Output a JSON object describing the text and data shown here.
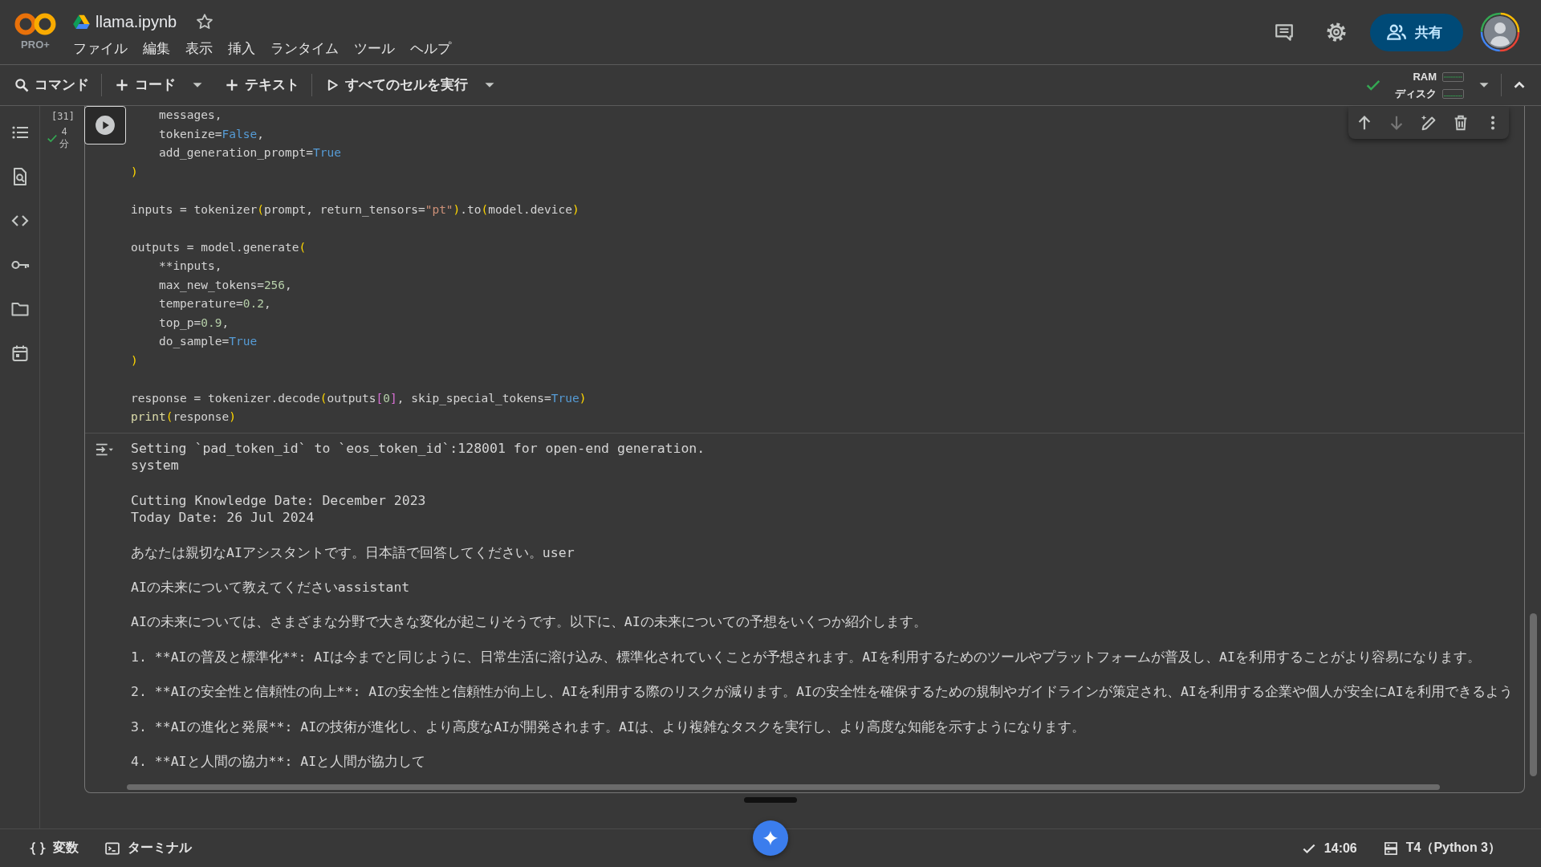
{
  "header": {
    "plan_badge": "PRO+",
    "title": "llama.ipynb",
    "starred": false,
    "menu": [
      "ファイル",
      "編集",
      "表示",
      "挿入",
      "ランタイム",
      "ツール",
      "ヘルプ"
    ],
    "share_button": "共有"
  },
  "toolbar": {
    "command": "コマンド",
    "add_code": "コード",
    "add_text": "テキスト",
    "run_all": "すべてのセルを実行",
    "connected": true,
    "resources": [
      {
        "label": "RAM"
      },
      {
        "label": "ディスク"
      }
    ]
  },
  "cell": {
    "execution_count": "[31]",
    "succeeded": true,
    "elapsed_value": "4",
    "elapsed_unit": "分",
    "toolbar": [
      {
        "disabled": false
      },
      {
        "disabled": true
      },
      {
        "disabled": false
      },
      {
        "disabled": false
      },
      {
        "disabled": false
      }
    ],
    "code_blocks": [
      [
        [
          {
            "text": "    messages,",
            "kind": "plain"
          }
        ],
        [
          {
            "text": "    tokenize=",
            "kind": "plain"
          },
          {
            "text": "False",
            "kind": "const"
          },
          {
            "text": ",",
            "kind": "plain"
          }
        ],
        [
          {
            "text": "    add_generation_prompt=",
            "kind": "plain"
          },
          {
            "text": "True",
            "kind": "const"
          }
        ],
        [
          {
            "text": ")",
            "kind": "paren"
          }
        ]
      ],
      [
        [
          {
            "text": "inputs = tokenizer",
            "kind": "plain"
          },
          {
            "text": "(",
            "kind": "paren"
          },
          {
            "text": "prompt, return_tensors=",
            "kind": "plain"
          },
          {
            "text": "\"pt\"",
            "kind": "str"
          },
          {
            "text": ")",
            "kind": "paren"
          },
          {
            "text": ".to",
            "kind": "plain"
          },
          {
            "text": "(",
            "kind": "paren"
          },
          {
            "text": "model.device",
            "kind": "plain"
          },
          {
            "text": ")",
            "kind": "paren"
          }
        ]
      ],
      [
        [
          {
            "text": "outputs = model.generate",
            "kind": "plain"
          },
          {
            "text": "(",
            "kind": "paren"
          }
        ],
        [
          {
            "text": "    **inputs,",
            "kind": "plain"
          }
        ],
        [
          {
            "text": "    max_new_tokens=",
            "kind": "plain"
          },
          {
            "text": "256",
            "kind": "num"
          },
          {
            "text": ",",
            "kind": "plain"
          }
        ],
        [
          {
            "text": "    temperature=",
            "kind": "plain"
          },
          {
            "text": "0.2",
            "kind": "num"
          },
          {
            "text": ",",
            "kind": "plain"
          }
        ],
        [
          {
            "text": "    top_p=",
            "kind": "plain"
          },
          {
            "text": "0.9",
            "kind": "num"
          },
          {
            "text": ",",
            "kind": "plain"
          }
        ],
        [
          {
            "text": "    do_sample=",
            "kind": "plain"
          },
          {
            "text": "True",
            "kind": "const"
          }
        ],
        [
          {
            "text": ")",
            "kind": "paren"
          }
        ]
      ],
      [
        [
          {
            "text": "response = tokenizer.decode",
            "kind": "plain"
          },
          {
            "text": "(",
            "kind": "paren"
          },
          {
            "text": "outputs",
            "kind": "plain"
          },
          {
            "text": "[",
            "kind": "bracket"
          },
          {
            "text": "0",
            "kind": "num"
          },
          {
            "text": "]",
            "kind": "bracket"
          },
          {
            "text": ", skip_special_tokens=",
            "kind": "plain"
          },
          {
            "text": "True",
            "kind": "const"
          },
          {
            "text": ")",
            "kind": "paren"
          }
        ],
        [
          {
            "text": "print",
            "kind": "fn"
          },
          {
            "text": "(",
            "kind": "paren"
          },
          {
            "text": "response",
            "kind": "plain"
          },
          {
            "text": ")",
            "kind": "paren"
          }
        ]
      ]
    ],
    "output_blocks": [
      [
        "Setting `pad_token_id` to `eos_token_id`:128001 for open-end generation.",
        "system"
      ],
      [
        "Cutting Knowledge Date: December 2023",
        "Today Date: 26 Jul 2024"
      ],
      [
        "あなたは親切なAIアシスタントです。日本語で回答してください。user"
      ],
      [
        "AIの未来について教えてくださいassistant"
      ],
      [
        "AIの未来については、さまざまな分野で大きな変化が起こりそうです。以下に、AIの未来についての予想をいくつか紹介します。"
      ],
      [
        "1. **AIの普及と標準化**: AIは今までと同じように、日常生活に溶け込み、標準化されていくことが予想されます。AIを利用するためのツールやプラットフォームが普及し、AIを利用することがより容易になります。"
      ],
      [
        "2. **AIの安全性と信頼性の向上**: AIの安全性と信頼性が向上し、AIを利用する際のリスクが減ります。AIの安全性を確保するための規制やガイドラインが策定され、AIを利用する企業や個人が安全にAIを利用できるよう"
      ],
      [
        "3. **AIの進化と発展**: AIの技術が進化し、より高度なAIが開発されます。AIは、より複雑なタスクを実行し、より高度な知能を示すようになります。"
      ],
      [
        "4. **AIと人間の協力**: AIと人間が協力して"
      ]
    ]
  },
  "status_bar": {
    "variables": "変数",
    "terminal": "ターミナル",
    "last_run": "14:06",
    "runtime": "T4（Python 3）"
  }
}
